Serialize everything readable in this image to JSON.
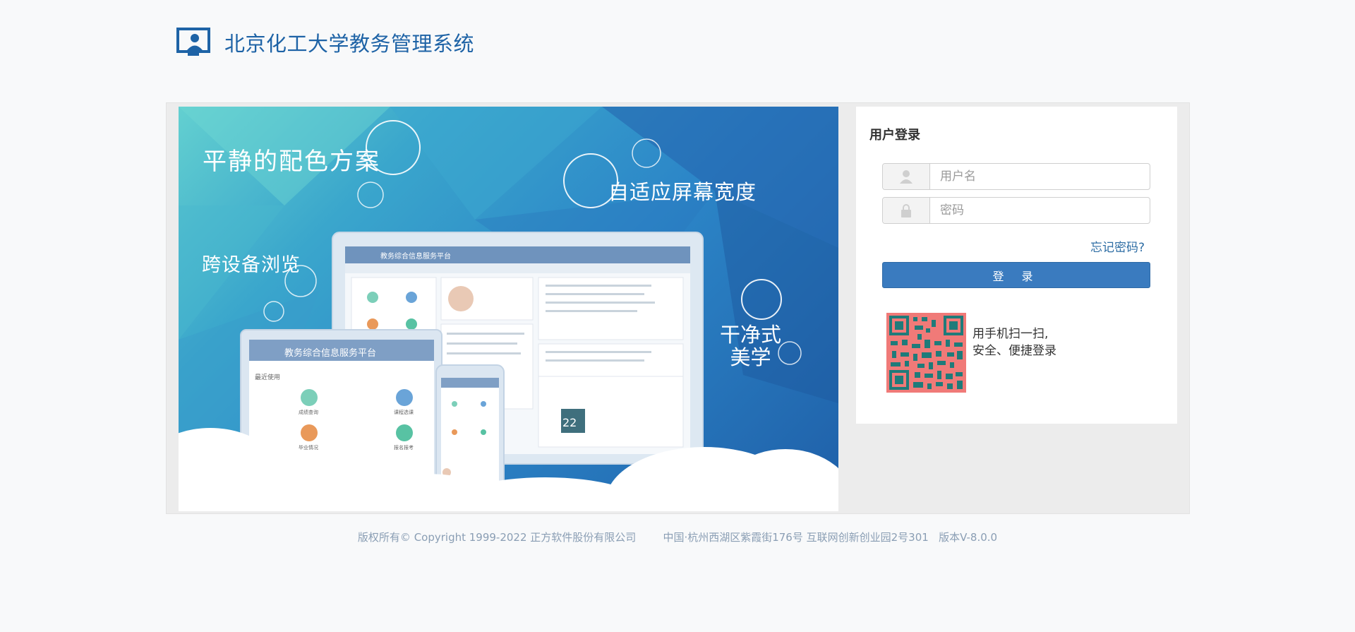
{
  "header": {
    "title": "北京化工大学教务管理系统",
    "logo_icon": "monitor-user-icon"
  },
  "banner": {
    "text_palette": "平静的配色方案",
    "text_adaptive": "自适应屏幕宽度",
    "text_cross_device": "跨设备浏览",
    "text_clean_line1": "干净式",
    "text_clean_line2": "美学",
    "mock_header_desktop": "教务综合信息服务平台",
    "mock_header_tablet": "教务综合信息服务平台",
    "mock_tablet_section": "最近使用",
    "mock_tablet_apps": [
      "成绩查询",
      "课程选课",
      "毕业情况",
      "报名报考"
    ],
    "mock_calendar_day": "22"
  },
  "login": {
    "title": "用户登录",
    "username_placeholder": "用户名",
    "password_placeholder": "密码",
    "forgot_label": "忘记密码?",
    "login_label": "登 录",
    "qr_line1": "用手机扫一扫,",
    "qr_line2": "安全、便捷登录",
    "user_icon": "user-icon",
    "lock_icon": "lock-icon",
    "qr_icon": "qr-code-icon"
  },
  "footer": {
    "copyright": "版权所有© Copyright 1999-2022 正方软件股份有限公司",
    "address": "中国·杭州西湖区紫霞街176号 互联网创新创业园2号301",
    "version": "版本V-8.0.0"
  },
  "colors": {
    "brand": "#1e63a6",
    "button": "#3a7bbf",
    "qr_bg": "#f07a78",
    "qr_fg": "#1f7b7a"
  }
}
